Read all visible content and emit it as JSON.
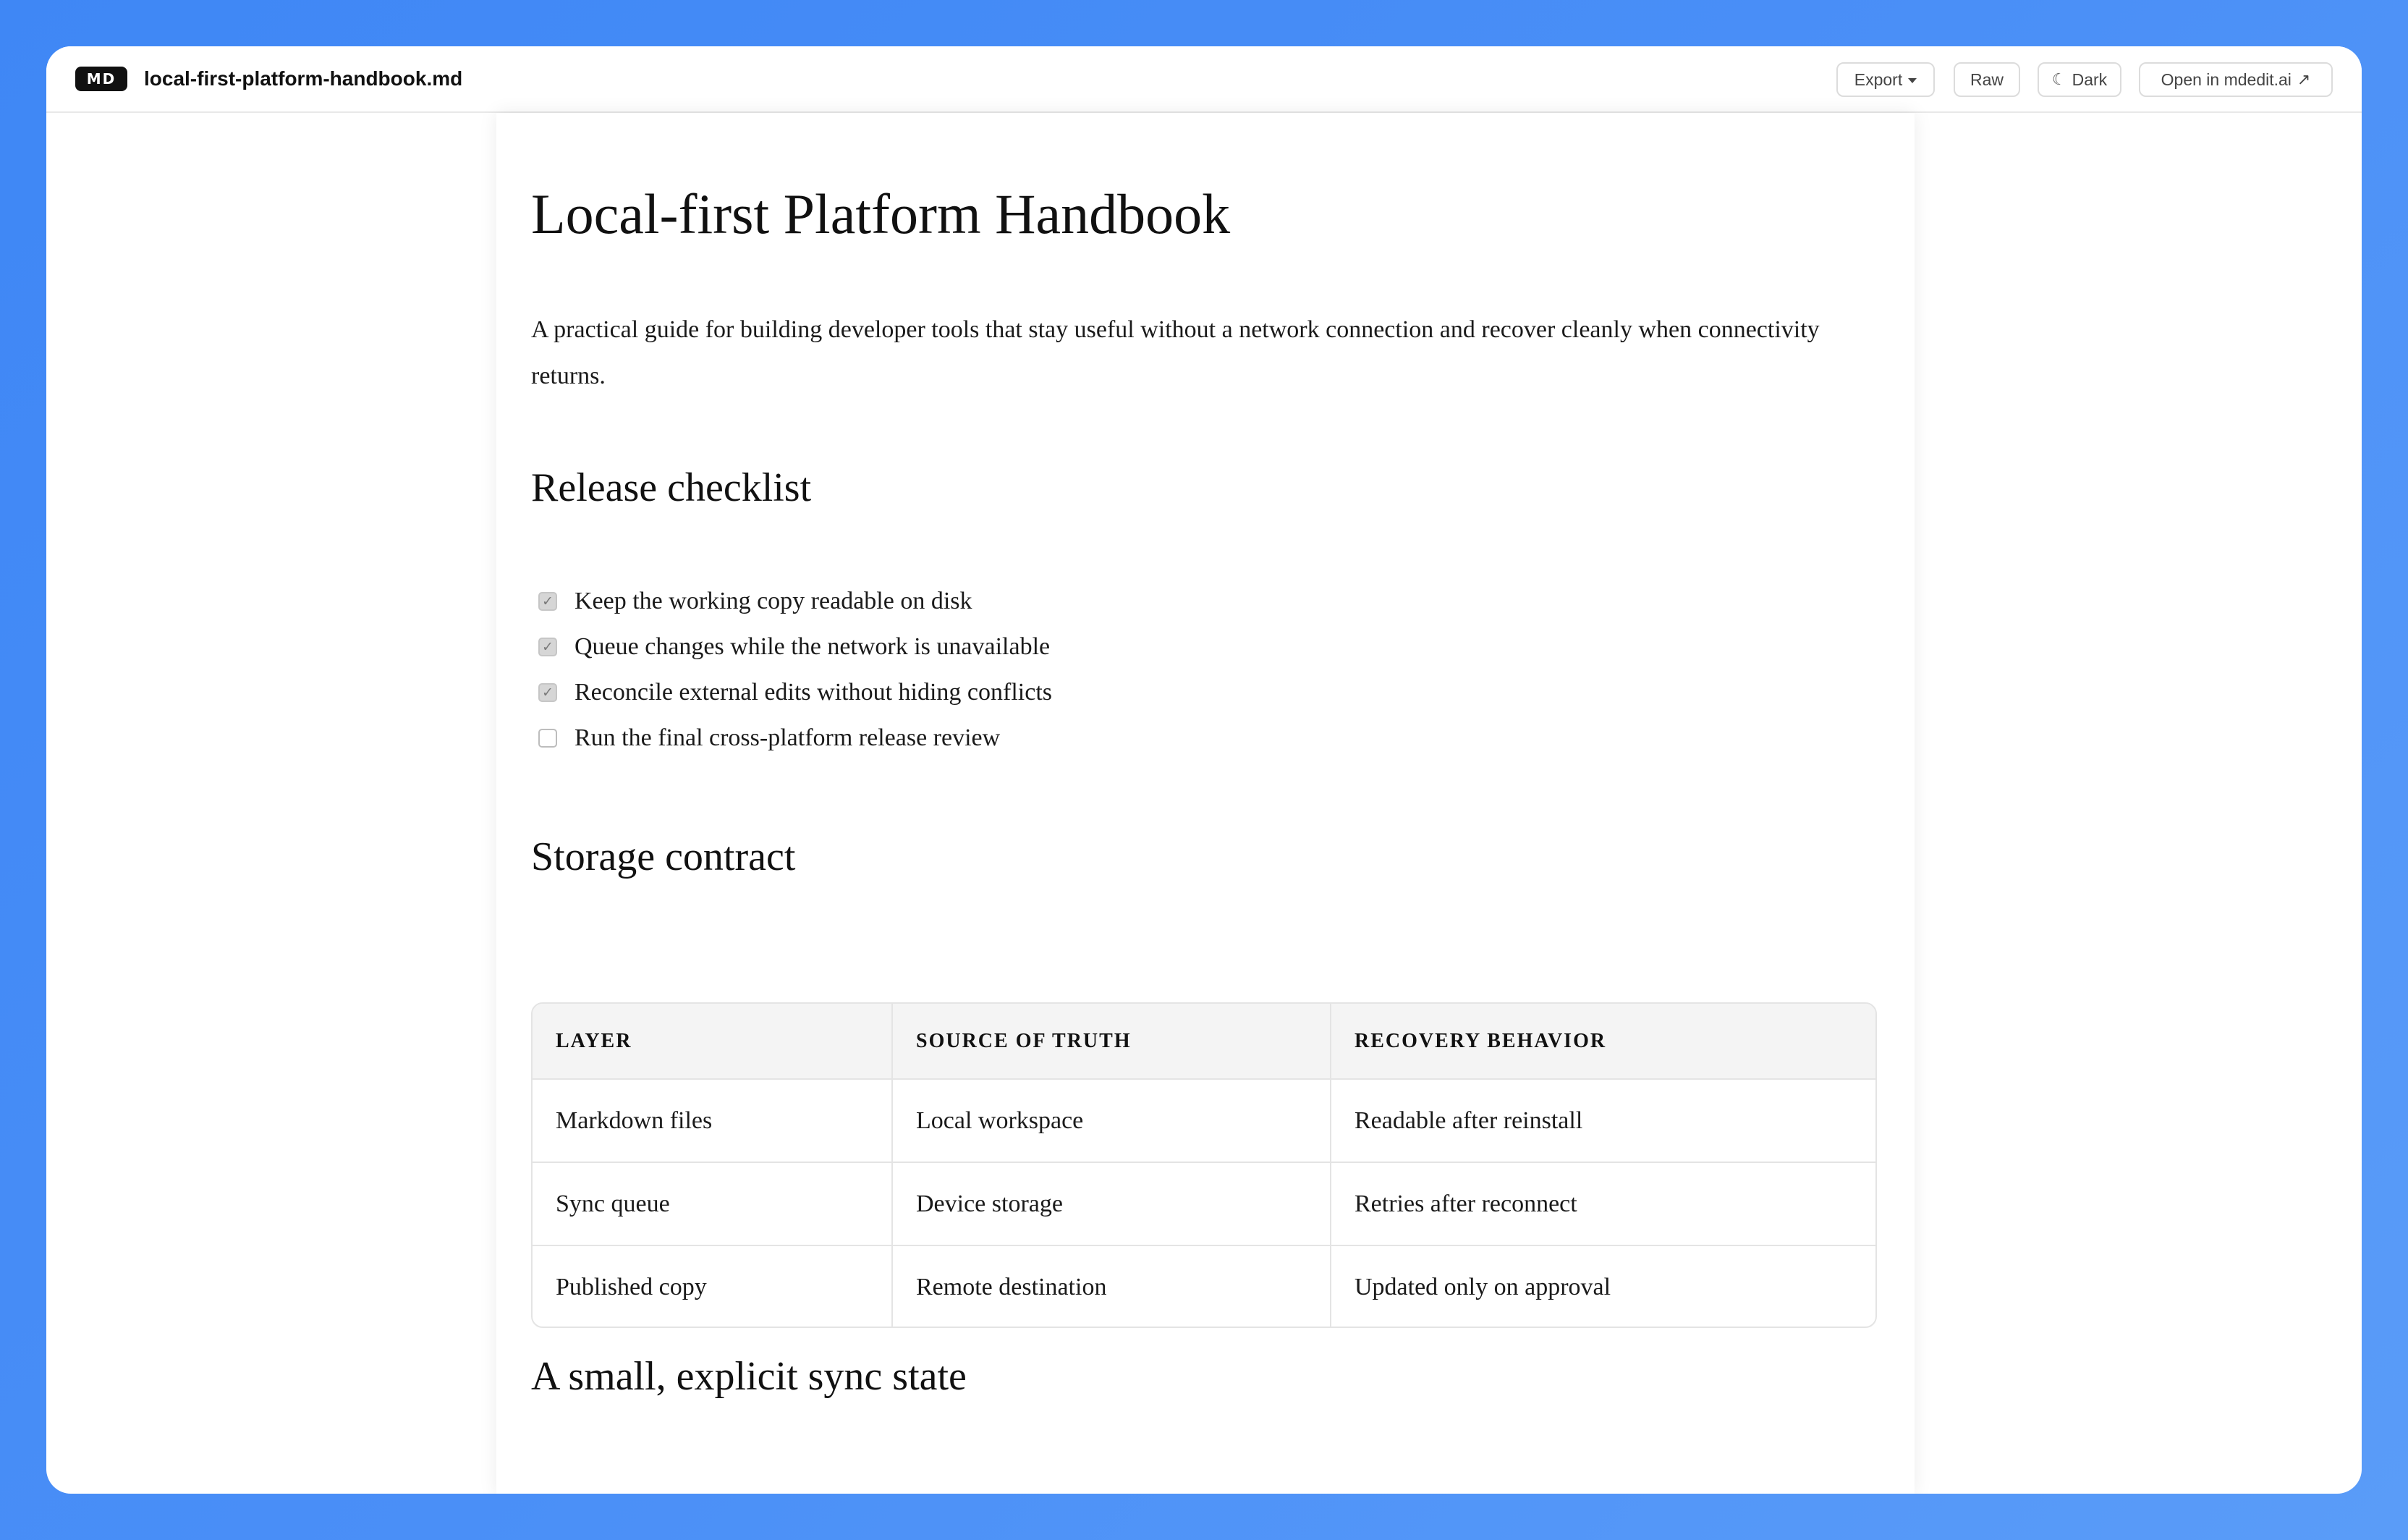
{
  "topbar": {
    "badge": "MD",
    "filename": "local-first-platform-handbook.md",
    "buttons": {
      "export": "Export",
      "raw": "Raw",
      "dark": "Dark",
      "open": "Open in mdedit.ai"
    }
  },
  "document": {
    "title": "Local-first Platform Handbook",
    "intro": "A practical guide for building developer tools that stay useful without a network connection and recover cleanly when connectivity returns.",
    "checklist": {
      "heading": "Release checklist",
      "items": [
        {
          "label": "Keep the working copy readable on disk",
          "checked": true
        },
        {
          "label": "Queue changes while the network is unavailable",
          "checked": true
        },
        {
          "label": "Reconcile external edits without hiding conflicts",
          "checked": true
        },
        {
          "label": "Run the final cross-platform release review",
          "checked": false
        }
      ]
    },
    "storage": {
      "heading": "Storage contract",
      "columns": [
        "LAYER",
        "SOURCE OF TRUTH",
        "RECOVERY BEHAVIOR"
      ],
      "rows": [
        [
          "Markdown files",
          "Local workspace",
          "Readable after reinstall"
        ],
        [
          "Sync queue",
          "Device storage",
          "Retries after reconnect"
        ],
        [
          "Published copy",
          "Remote destination",
          "Updated only on approval"
        ]
      ]
    },
    "sync_heading": "A small, explicit sync state"
  },
  "icons": {
    "export_caret": "caret-down-icon",
    "dark_mode": "moon-icon",
    "open_external": "arrow-up-right-icon"
  },
  "colors": {
    "background": "#4a8ff7",
    "badge": "#111111",
    "table_header": "#f4f4f4"
  }
}
